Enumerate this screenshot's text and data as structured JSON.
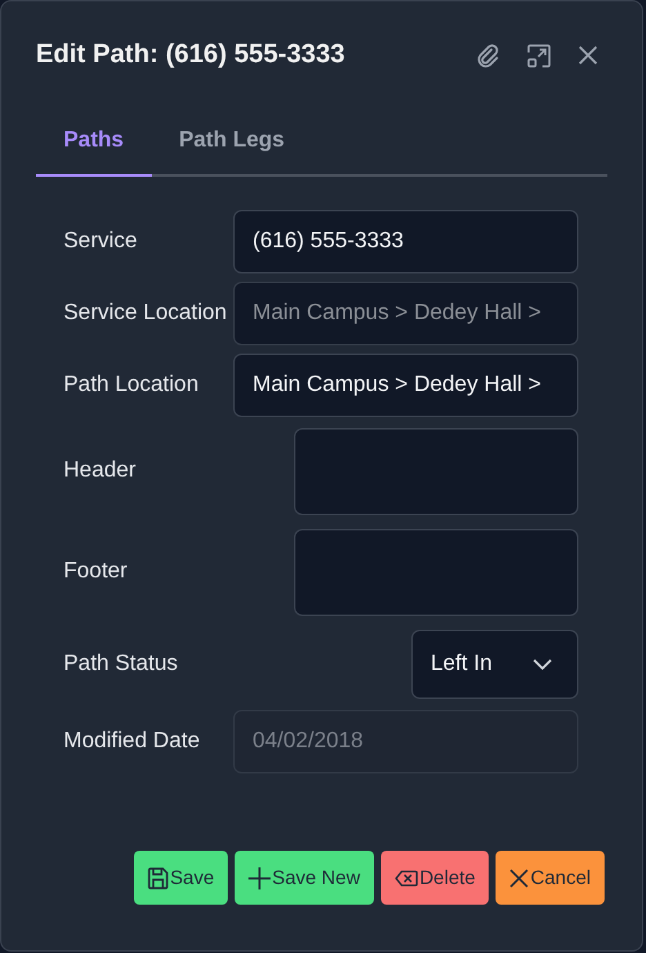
{
  "dialog": {
    "title": "Edit Path: (616) 555-3333"
  },
  "tabs": [
    {
      "label": "Paths",
      "selected": true
    },
    {
      "label": "Path Legs",
      "selected": false
    }
  ],
  "fields": [
    {
      "kind": "text",
      "label": "Service",
      "value": "(616) 555-3333",
      "readonly": false,
      "disabled": false
    },
    {
      "kind": "text",
      "label": "Service Location",
      "value": "Main Campus > Dedey Hall >",
      "readonly": true,
      "disabled": false
    },
    {
      "kind": "text",
      "label": "Path Location",
      "value": "Main Campus > Dedey Hall >",
      "readonly": false,
      "disabled": false
    },
    {
      "kind": "textarea",
      "label": "Header",
      "disabled": false
    },
    {
      "kind": "textarea",
      "label": "Footer",
      "disabled": false
    },
    {
      "kind": "select",
      "label": "Path Status",
      "value": "Left In",
      "readonly": false,
      "disabled": false
    },
    {
      "kind": "text",
      "label": "Modified Date",
      "value": "04/02/2018",
      "readonly": false,
      "disabled": true
    }
  ],
  "buttons": [
    {
      "kind": "save",
      "label": "Save"
    },
    {
      "kind": "add",
      "label": "Save New"
    },
    {
      "kind": "delete",
      "label": "Delete"
    },
    {
      "kind": "cancel",
      "label": "Cancel"
    }
  ]
}
